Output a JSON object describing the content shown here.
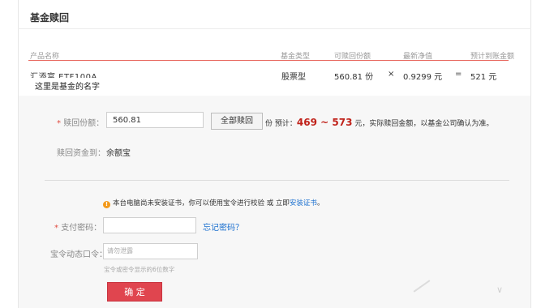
{
  "page": {
    "title": "基金赎回"
  },
  "table": {
    "headers": {
      "name": "产品名称",
      "type": "基金类型",
      "redeemable": "可赎回份额",
      "nav": "最新净值",
      "estimate": "预计到账金额"
    },
    "row": {
      "name": "汇添富 ETF100A",
      "tooltip": "这里是基金的名字",
      "type": "股票型",
      "shares": "560.81 份",
      "times": "×",
      "nav": "0.9299 元",
      "equals": "=",
      "amount": "521 元"
    }
  },
  "form": {
    "required_mark": "*",
    "amount_label": "赎回份额：",
    "amount_value": "560.81",
    "redeem_all_label": "全部赎回",
    "unit_label": "份",
    "estimate_prefix": "预计：",
    "estimate_low": "469",
    "estimate_sep": " ~ ",
    "estimate_high": "573",
    "estimate_suffix": "元，实际赎回金额，以基金公司确认为准。",
    "dest_label": "赎回资金到：",
    "dest_value": "余额宝",
    "warn_icon": "!",
    "warn_text": "本台电脑尚未安装证书，你可以使用宝令进行校验 或 立即",
    "install_link": "安装证书",
    "warn_end": "。",
    "pay_pwd_label": "支付密码：",
    "forgot_link": "忘记密码？",
    "otp_label": "宝令动态口令：",
    "otp_placeholder": "请勿泄露",
    "otp_hint": "宝令或密令显示的6位数字",
    "confirm_label": "确 定"
  },
  "colors": {
    "accent_line": "#e8685e",
    "estimate_red": "#c0221a",
    "confirm_button": "#e0454f",
    "link_blue": "#1a6fcf",
    "warning_orange": "#f39a1c"
  }
}
